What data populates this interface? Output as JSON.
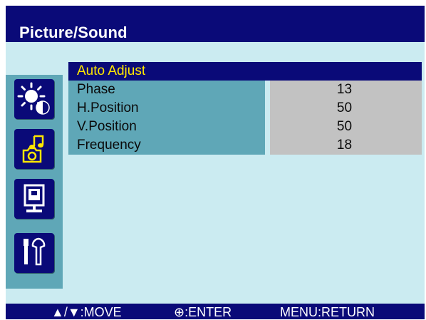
{
  "title": "Picture/Sound",
  "menu": {
    "items": [
      {
        "label": "Auto Adjust",
        "value": ""
      },
      {
        "label": "Phase",
        "value": "13"
      },
      {
        "label": "H.Position",
        "value": "50"
      },
      {
        "label": "V.Position",
        "value": "50"
      },
      {
        "label": "Frequency",
        "value": "18"
      }
    ],
    "selected_index": 0
  },
  "sidebar": {
    "icons": [
      {
        "name": "brightness-contrast-icon"
      },
      {
        "name": "music-camera-icon"
      },
      {
        "name": "display-monitor-icon"
      },
      {
        "name": "tools-icon"
      }
    ]
  },
  "footer": {
    "move": "▲/▼:MOVE",
    "enter": "⊕:ENTER",
    "return": "MENU:RETURN"
  },
  "colors": {
    "background": "#cbebf1",
    "title_bar": "#0a0a78",
    "selected_row": "#0a0a78",
    "selected_text": "#ffe600",
    "label_cell": "#5fa7b7",
    "value_cell": "#c2c2c2",
    "icon_yellow": "#ffe600"
  }
}
